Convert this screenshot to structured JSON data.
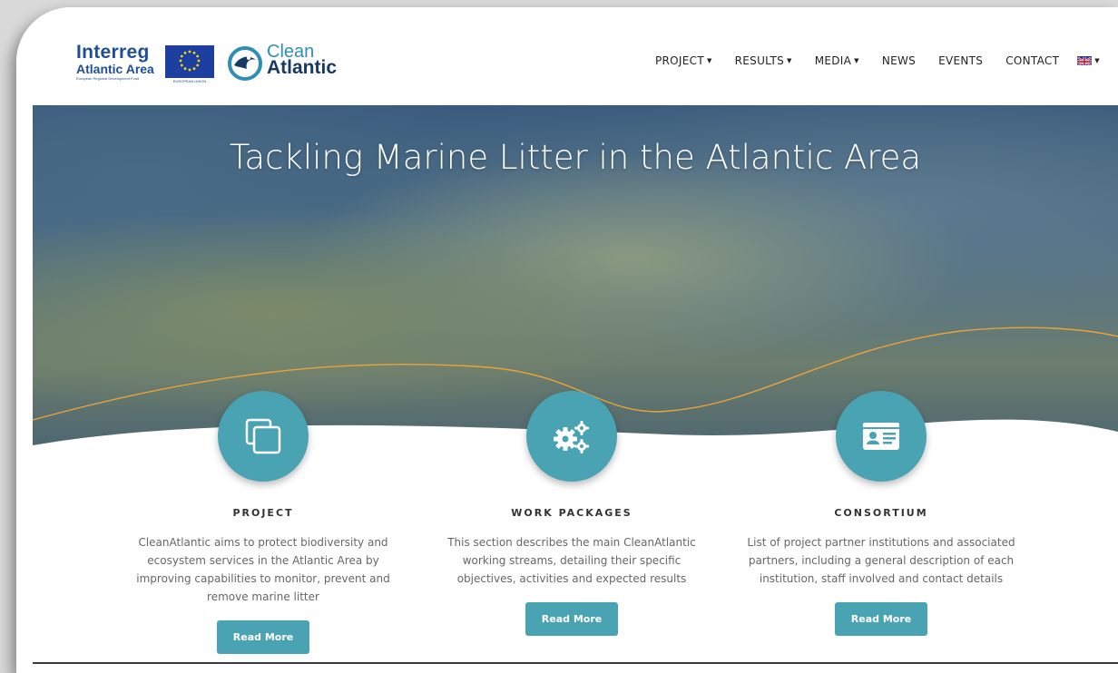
{
  "logos": {
    "interreg": "Interreg",
    "interreg_sub": "Atlantic Area",
    "interreg_fund": "European Regional Development Fund",
    "eu_label": "EUROPEAN UNION",
    "clean": "Clean",
    "atlantic": "Atlantic"
  },
  "nav": {
    "items": [
      {
        "label": "PROJECT",
        "dropdown": true
      },
      {
        "label": "RESULTS",
        "dropdown": true
      },
      {
        "label": "MEDIA",
        "dropdown": true
      },
      {
        "label": "NEWS",
        "dropdown": false
      },
      {
        "label": "EVENTS",
        "dropdown": false
      },
      {
        "label": "CONTACT",
        "dropdown": false
      }
    ],
    "language_icon": "uk-flag-icon"
  },
  "hero": {
    "title": "Tackling Marine Litter in the Atlantic Area"
  },
  "features": [
    {
      "icon": "copy-icon",
      "title": "PROJECT",
      "description": "CleanAtlantic aims to protect biodiversity and ecosystem services in the Atlantic Area by improving capabilities to monitor, prevent and remove marine litter",
      "button": "Read More"
    },
    {
      "icon": "cogs-icon",
      "title": "WORK PACKAGES",
      "description": "This section describes the main CleanAtlantic working streams, detailing their specific objectives, activities and expected results",
      "button": "Read More"
    },
    {
      "icon": "id-card-icon",
      "title": "CONSORTIUM",
      "description": "List of project partner institutions and associated partners, including a general description of each institution, staff involved and contact details",
      "button": "Read More"
    }
  ],
  "colors": {
    "accent": "#4aa3b3",
    "wave_line": "#e8a33a",
    "brand_dark": "#1d4f96"
  }
}
